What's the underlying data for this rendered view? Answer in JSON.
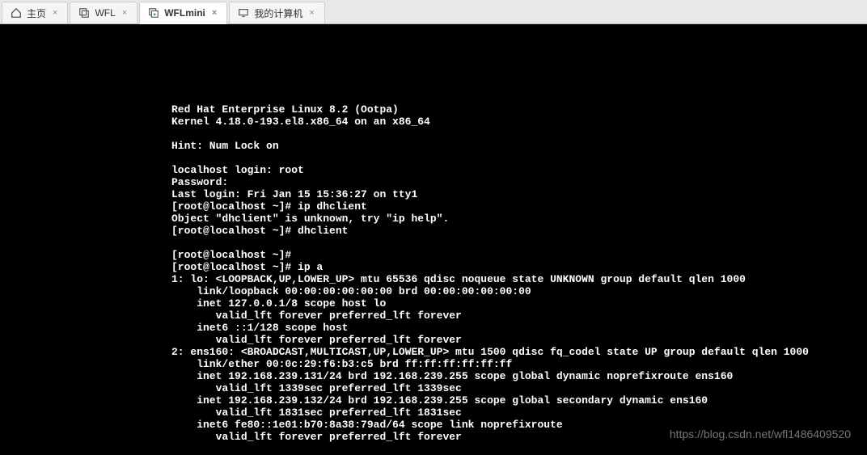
{
  "tabs": [
    {
      "label": "主页",
      "closable": true,
      "active": false,
      "icon": "home"
    },
    {
      "label": "WFL",
      "closable": true,
      "active": false,
      "icon": "stack"
    },
    {
      "label": "WFLmini",
      "closable": true,
      "active": true,
      "icon": "stack-play"
    },
    {
      "label": "我的计算机",
      "closable": true,
      "active": false,
      "icon": "monitor"
    }
  ],
  "terminal_lines": [
    "Red Hat Enterprise Linux 8.2 (Ootpa)",
    "Kernel 4.18.0-193.el8.x86_64 on an x86_64",
    "",
    "Hint: Num Lock on",
    "",
    "localhost login: root",
    "Password:",
    "Last login: Fri Jan 15 15:36:27 on tty1",
    "[root@localhost ~]# ip dhclient",
    "Object \"dhclient\" is unknown, try \"ip help\".",
    "[root@localhost ~]# dhclient",
    "",
    "[root@localhost ~]#",
    "[root@localhost ~]# ip a",
    "1: lo: <LOOPBACK,UP,LOWER_UP> mtu 65536 qdisc noqueue state UNKNOWN group default qlen 1000",
    "    link/loopback 00:00:00:00:00:00 brd 00:00:00:00:00:00",
    "    inet 127.0.0.1/8 scope host lo",
    "       valid_lft forever preferred_lft forever",
    "    inet6 ::1/128 scope host",
    "       valid_lft forever preferred_lft forever",
    "2: ens160: <BROADCAST,MULTICAST,UP,LOWER_UP> mtu 1500 qdisc fq_codel state UP group default qlen 1000",
    "    link/ether 00:0c:29:f6:b3:c5 brd ff:ff:ff:ff:ff:ff",
    "    inet 192.168.239.131/24 brd 192.168.239.255 scope global dynamic noprefixroute ens160",
    "       valid_lft 1339sec preferred_lft 1339sec",
    "    inet 192.168.239.132/24 brd 192.168.239.255 scope global secondary dynamic ens160",
    "       valid_lft 1831sec preferred_lft 1831sec",
    "    inet6 fe80::1e01:b70:8a38:79ad/64 scope link noprefixroute",
    "       valid_lft forever preferred_lft forever"
  ],
  "watermark": "https://blog.csdn.net/wfl1486409520"
}
